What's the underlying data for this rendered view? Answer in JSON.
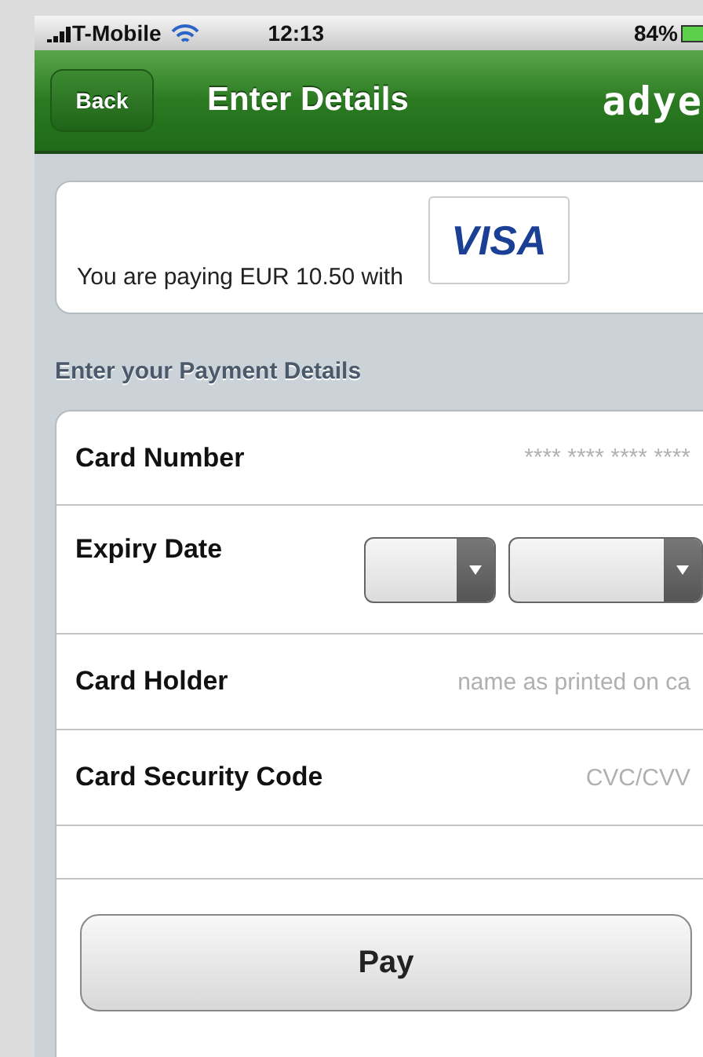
{
  "status_bar": {
    "carrier": "T-Mobile",
    "time": "12:13",
    "battery": "84%"
  },
  "nav_bar": {
    "back": "Back",
    "title": "Enter Details",
    "logo": "adye"
  },
  "summary": {
    "text": "You are paying EUR 10.50 with",
    "card_brand": "VISA"
  },
  "section_title": "Enter your Payment Details",
  "fields": [
    {
      "kind": "text",
      "label": "Card Number",
      "placeholder": "**** **** **** ****"
    },
    {
      "kind": "dropdowns",
      "label": "Expiry Date",
      "dropdowns": [
        {
          "kind": "dropdown"
        },
        {
          "kind": "dropdown"
        }
      ]
    },
    {
      "kind": "text",
      "label": "Card Holder",
      "placeholder": "name as printed on ca"
    },
    {
      "kind": "text",
      "label": "Card Security Code",
      "placeholder": "CVC/CVV"
    },
    {
      "kind": "blank"
    }
  ],
  "pay_button": "Pay"
}
